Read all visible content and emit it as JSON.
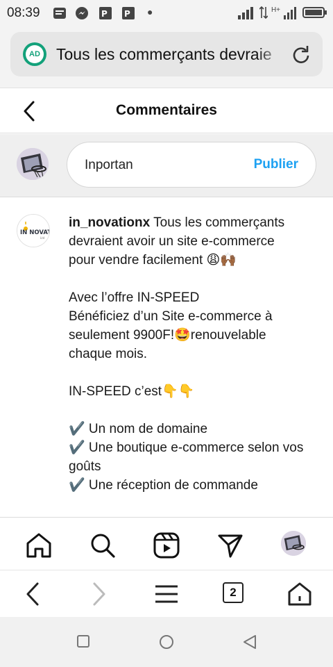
{
  "status_bar": {
    "time": "08:39",
    "network": "H+",
    "icons": [
      "notes-icon",
      "messenger-icon",
      "pdf-icon",
      "pdf-icon",
      "dot-icon",
      "signal-icon",
      "battery-icon"
    ]
  },
  "browser": {
    "ad_badge": "AD",
    "url_text": "Tous les commerçants devraie",
    "tab_count": "2"
  },
  "header": {
    "title": "Commentaires"
  },
  "comment_input": {
    "value": "Inportan",
    "publish_label": "Publier"
  },
  "post": {
    "username": "in_novationx",
    "lines": [
      " Tous les commerçants devraient avoir un site e-commerce pour vendre facilement 😩🙌🏾",
      "Avec l’offre IN-SPEED",
      "Bénéficiez d’un Site e-commerce à seulement 9900F!🤩renouvelable chaque mois.",
      "IN-SPEED c’est👇👇",
      "✔️ Un nom de domaine",
      "✔️ Une boutique e-commerce selon vos goûts",
      "✔️ Une réception de commande"
    ],
    "avatar_logo": "IN NOVATION"
  },
  "colors": {
    "accent": "#1da1f2",
    "ad_green": "#13a17a",
    "bar_bg": "#f3f3f3",
    "input_bg": "#efefef"
  }
}
